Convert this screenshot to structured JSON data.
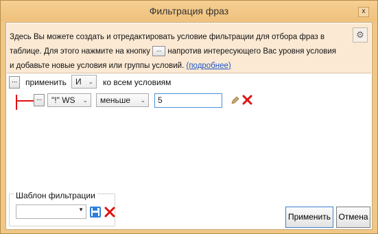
{
  "window": {
    "title": "Фильтрация фраз",
    "close_glyph": "x"
  },
  "info": {
    "text_1": "Здесь Вы можете создать и отредактировать условие фильтрации для отбора фраз в таблице. Для этого нажмите на кнопку",
    "button_glyph": "...",
    "text_2": "напротив интересующего Вас уровня условия и добавьте новые условия или группы условий.",
    "link_text": "(подробнее)",
    "settings_icon": "gear-icon"
  },
  "root_condition": {
    "menu_glyph": "...",
    "apply_label": "применить",
    "operator_value": "И",
    "suffix_label": "ко всем условиям"
  },
  "condition_row": {
    "menu_glyph": "...",
    "field_value": "\"!\" WS",
    "comparison_value": "меньше",
    "input_value": "5",
    "edit_icon": "pencil-icon",
    "delete_icon": "delete-x-icon"
  },
  "template": {
    "caption": "Шаблон фильтрации",
    "selected_value": "",
    "save_icon": "floppy-disk-icon",
    "delete_icon": "delete-x-icon"
  },
  "buttons": {
    "apply_label": "Применить",
    "cancel_label": "Отмена"
  },
  "colors": {
    "frame": "#f0c786",
    "info_background": "#fbe9d4",
    "link": "#1a56c8",
    "tree_line": "#e01010",
    "delete": "#e01010",
    "save_icon": "#2f7fd8"
  }
}
